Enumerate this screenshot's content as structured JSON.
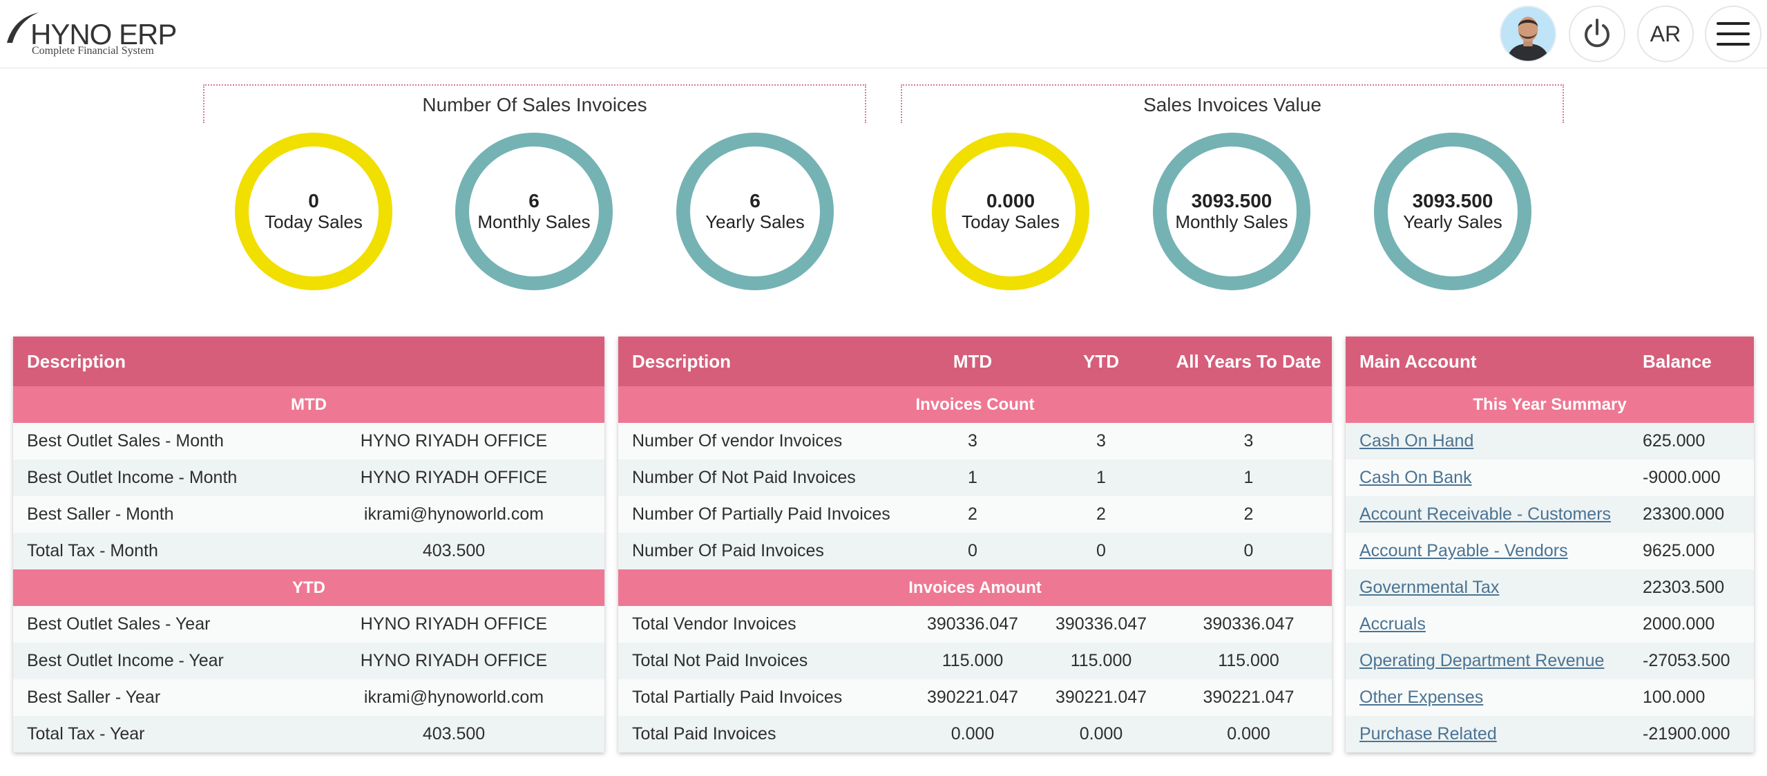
{
  "header": {
    "logo_text": "HYNO ERP",
    "logo_subtitle": "Complete Financial System",
    "language_label": "AR"
  },
  "kpi": {
    "count_group": {
      "title": "Number Of Sales Invoices",
      "rings": [
        {
          "value": "0",
          "label": "Today Sales",
          "color": "#f1df00"
        },
        {
          "value": "6",
          "label": "Monthly Sales",
          "color": "#75b2b4"
        },
        {
          "value": "6",
          "label": "Yearly Sales",
          "color": "#75b2b4"
        }
      ]
    },
    "value_group": {
      "title": "Sales Invoices Value",
      "rings": [
        {
          "value": "0.000",
          "label": "Today Sales",
          "color": "#f1df00"
        },
        {
          "value": "3093.500",
          "label": "Monthly Sales",
          "color": "#75b2b4"
        },
        {
          "value": "3093.500",
          "label": "Yearly Sales",
          "color": "#75b2b4"
        }
      ]
    }
  },
  "table1": {
    "header": "Description",
    "mtd_section": "MTD",
    "mtd_rows": [
      {
        "label": "Best Outlet Sales - Month",
        "value": "HYNO RIYADH OFFICE"
      },
      {
        "label": "Best Outlet Income - Month",
        "value": "HYNO RIYADH OFFICE"
      },
      {
        "label": "Best Saller - Month",
        "value": "ikrami@hynoworld.com"
      },
      {
        "label": "Total Tax - Month",
        "value": "403.500"
      }
    ],
    "ytd_section": "YTD",
    "ytd_rows": [
      {
        "label": "Best Outlet Sales - Year",
        "value": "HYNO RIYADH OFFICE"
      },
      {
        "label": "Best Outlet Income - Year",
        "value": "HYNO RIYADH OFFICE"
      },
      {
        "label": "Best Saller - Year",
        "value": "ikrami@hynoworld.com"
      },
      {
        "label": "Total Tax - Year",
        "value": "403.500"
      }
    ]
  },
  "table2": {
    "headers": [
      "Description",
      "MTD",
      "YTD",
      "All Years To Date"
    ],
    "count_section": "Invoices Count",
    "count_rows": [
      {
        "label": "Number Of vendor Invoices",
        "mtd": "3",
        "ytd": "3",
        "all": "3"
      },
      {
        "label": "Number Of Not Paid Invoices",
        "mtd": "1",
        "ytd": "1",
        "all": "1"
      },
      {
        "label": "Number Of Partially Paid Invoices",
        "mtd": "2",
        "ytd": "2",
        "all": "2"
      },
      {
        "label": "Number Of Paid Invoices",
        "mtd": "0",
        "ytd": "0",
        "all": "0"
      }
    ],
    "amount_section": "Invoices Amount",
    "amount_rows": [
      {
        "label": "Total Vendor Invoices",
        "mtd": "390336.047",
        "ytd": "390336.047",
        "all": "390336.047"
      },
      {
        "label": "Total Not Paid Invoices",
        "mtd": "115.000",
        "ytd": "115.000",
        "all": "115.000"
      },
      {
        "label": "Total Partially Paid Invoices",
        "mtd": "390221.047",
        "ytd": "390221.047",
        "all": "390221.047"
      },
      {
        "label": "Total Paid Invoices",
        "mtd": "0.000",
        "ytd": "0.000",
        "all": "0.000"
      }
    ]
  },
  "table3": {
    "headers": [
      "Main Account",
      "Balance"
    ],
    "section": "This Year Summary",
    "rows": [
      {
        "account": "Cash On Hand",
        "balance": "625.000"
      },
      {
        "account": "Cash On Bank",
        "balance": "-9000.000"
      },
      {
        "account": "Account Receivable - Customers",
        "balance": "23300.000"
      },
      {
        "account": "Account Payable - Vendors",
        "balance": "9625.000"
      },
      {
        "account": "Governmental Tax",
        "balance": "22303.500"
      },
      {
        "account": "Accruals",
        "balance": "2000.000"
      },
      {
        "account": "Operating Department Revenue",
        "balance": "-27053.500"
      },
      {
        "account": "Other Expenses",
        "balance": "100.000"
      },
      {
        "account": "Purchase Related",
        "balance": "-21900.000"
      }
    ]
  },
  "colors": {
    "header_pink": "#d65e7b",
    "section_pink": "#ee7893",
    "ring_teal": "#75b2b4",
    "ring_yellow": "#f1df00",
    "link_blue": "#4a7393"
  }
}
